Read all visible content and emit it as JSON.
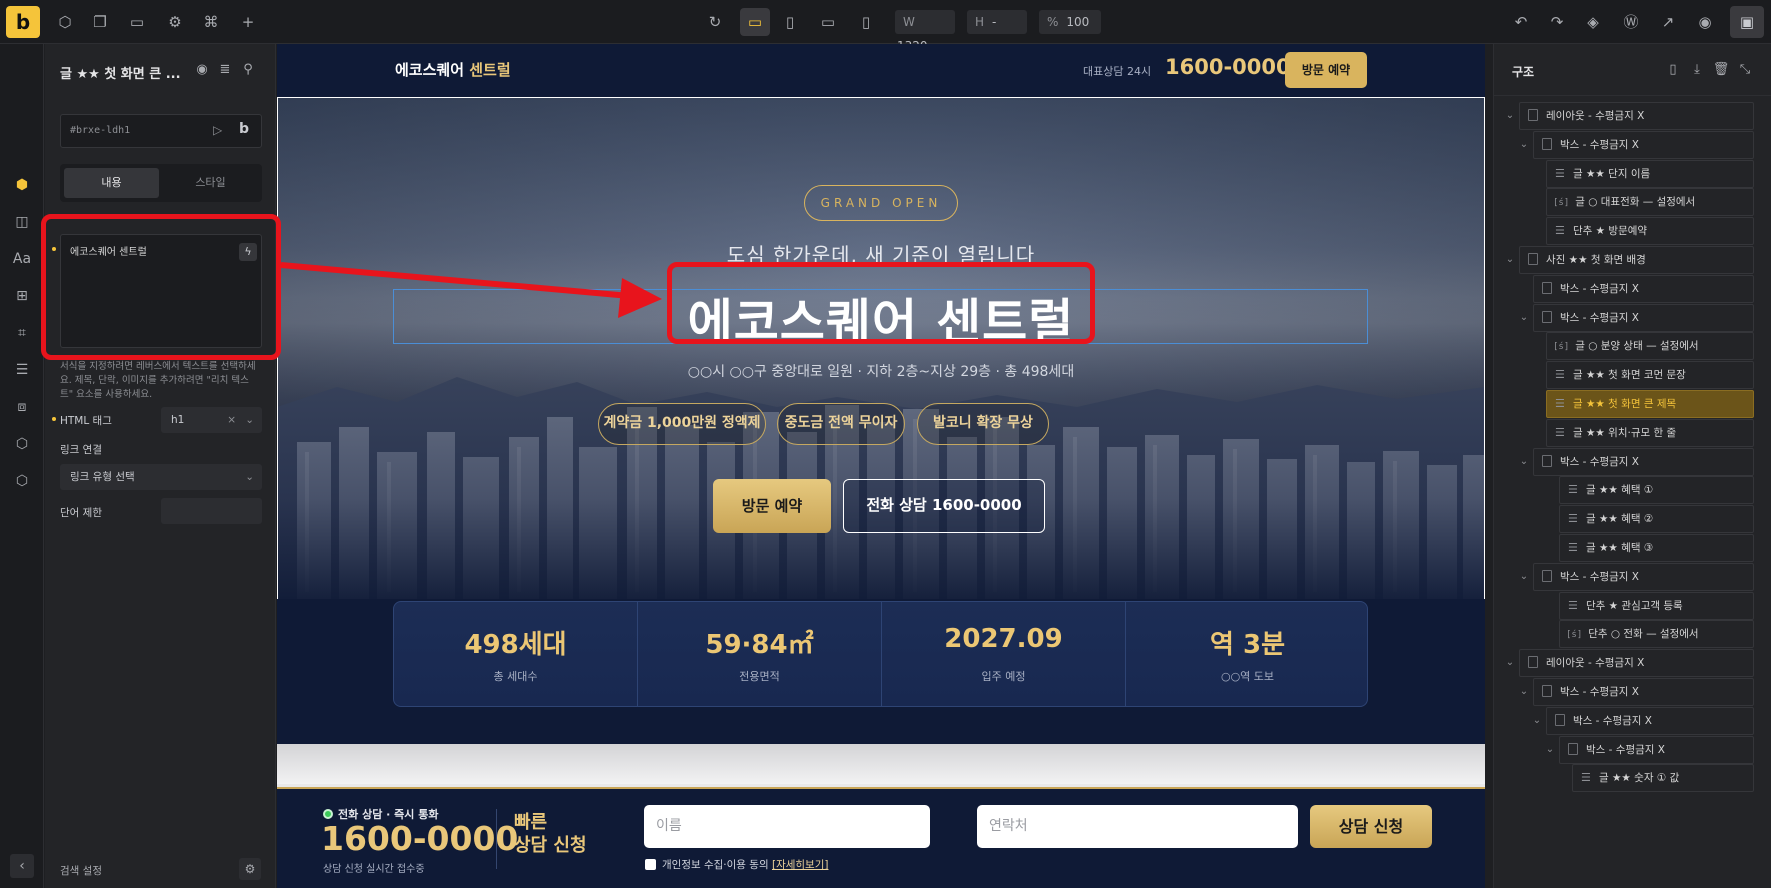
{
  "topbar": {
    "logo": "b",
    "width_label": "W",
    "width_value": "1320",
    "height_label": "H",
    "height_value": "-",
    "zoom_label": "%",
    "zoom_value": "100"
  },
  "left_panel": {
    "title": "글 ★★ 첫 화면 큰 ...",
    "element_id": "#brxe-ldh1",
    "tabs": [
      "내용",
      "스타일"
    ],
    "text_content": "에코스퀘어 센트럴",
    "hint": "서식을 지정하려면 레버스에서 텍스트를 선택하세요. 제목, 단락, 이미지를 추가하려면 \"리치 텍스트\" 요소를 사용하세요.",
    "html_tag_label": "HTML 태그",
    "html_tag_value": "h1",
    "link_label": "링크 연결",
    "link_placeholder": "링크 유형 선택",
    "word_limit_label": "단어 제한",
    "footer_label": "검색 설정"
  },
  "site": {
    "brand_main": "에코스퀘어",
    "brand_accent": "센트럴",
    "rep_label": "대표상담 24시",
    "phone": "1600-0000",
    "visit_button": "방문 예약",
    "hero": {
      "badge": "GRAND OPEN",
      "subtitle": "도심 한가운데, 새 기준이 열립니다",
      "title": "에코스퀘어 센트럴",
      "location": "○○시 ○○구 중앙대로 일원 · 지하 2층~지상 29층 · 총 498세대",
      "benefits": [
        "계약금 1,000만원 정액제",
        "중도금 전액 무이자",
        "발코니 확장 무상"
      ],
      "cta_visit": "방문 예약",
      "cta_phone": "전화 상담 1600-0000"
    },
    "stats": [
      {
        "value": "498세대",
        "caption": "총 세대수"
      },
      {
        "value": "59·84㎡",
        "caption": "전용면적"
      },
      {
        "value": "2027.09",
        "caption": "입주 예정"
      },
      {
        "value": "역 3분",
        "caption": "○○역 도보"
      }
    ],
    "cta_bar": {
      "live_label": "전화 상담 · 즉시 통화",
      "phone": "1600-0000",
      "note": "상담 신청 실시간 접수중",
      "quick_line1": "빠른",
      "quick_line2": "상담 신청",
      "name_placeholder": "이름",
      "contact_placeholder": "연락처",
      "submit": "상담 신청",
      "consent": "개인정보 수집·이용 동의",
      "consent_link": "[자세히보기]"
    }
  },
  "right_panel": {
    "title": "구조",
    "tree": [
      {
        "label": "레이아웃 - 수평금지 X",
        "type": "box"
      },
      {
        "label": "박스 - 수평금지 X",
        "type": "box"
      },
      {
        "label": "글 ★★ 단지 이름",
        "type": "text"
      },
      {
        "label": "글 ○ 대표전화 — 설정에서",
        "type": "code"
      },
      {
        "label": "단추 ★ 방문예약",
        "type": "text"
      },
      {
        "label": "사진 ★★ 첫 화면 배경",
        "type": "box"
      },
      {
        "label": "박스 - 수평금지 X",
        "type": "box"
      },
      {
        "label": "박스 - 수평금지 X",
        "type": "box"
      },
      {
        "label": "글 ○ 분양 상태 — 설정에서",
        "type": "code"
      },
      {
        "label": "글 ★★ 첫 화면 코먼 문장",
        "type": "text"
      },
      {
        "label": "글 ★★ 첫 화면 큰 제목",
        "type": "text"
      },
      {
        "label": "글 ★★ 위치·규모 한 줄",
        "type": "text"
      },
      {
        "label": "박스 - 수평금지 X",
        "type": "box"
      },
      {
        "label": "글 ★★ 혜택 ①",
        "type": "text"
      },
      {
        "label": "글 ★★ 혜택 ②",
        "type": "text"
      },
      {
        "label": "글 ★★ 혜택 ③",
        "type": "text"
      },
      {
        "label": "박스 - 수평금지 X",
        "type": "box"
      },
      {
        "label": "단추 ★ 관심고객 등록",
        "type": "text"
      },
      {
        "label": "단추 ○ 전화 — 설정에서",
        "type": "code"
      },
      {
        "label": "레이아웃 - 수평금지 X",
        "type": "box"
      },
      {
        "label": "박스 - 수평금지 X",
        "type": "box"
      },
      {
        "label": "박스 - 수평금지 X",
        "type": "box"
      },
      {
        "label": "박스 - 수평금지 X",
        "type": "box"
      },
      {
        "label": "글 ★★ 숫자 ① 값",
        "type": "text"
      }
    ]
  },
  "colors": {
    "accent": "#f5c43a",
    "gold": "#d9b45e",
    "navy": "#0f1a36",
    "annotation_red": "#e8141c",
    "selection_blue": "#4b8ed6"
  }
}
